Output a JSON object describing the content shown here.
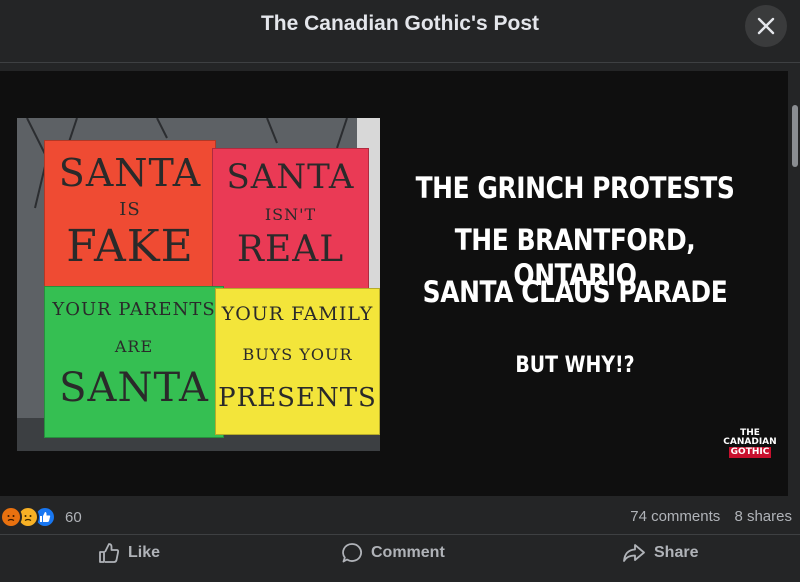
{
  "header": {
    "title": "The Canadian Gothic's Post"
  },
  "post": {
    "signs": [
      {
        "lines": [
          "SANTA",
          "IS",
          "FAKE"
        ],
        "color": "#ef4b33"
      },
      {
        "lines": [
          "SANTA",
          "ISN'T",
          "REAL"
        ],
        "color": "#ea3a55"
      },
      {
        "lines": [
          "YOUR PARENTS",
          "ARE",
          "SANTA"
        ],
        "color": "#35bf52"
      },
      {
        "lines": [
          "YOUR FAMILY",
          "BUYS YOUR",
          "PRESENTS"
        ],
        "color": "#f3e53a"
      }
    ],
    "headline": [
      "THE GRINCH PROTESTS",
      "THE BRANTFORD, ONTARIO",
      "SANTA CLAUS PARADE"
    ],
    "subhead": "BUT WHY!?",
    "logo_text": [
      "THE",
      "CANADIAN",
      "GOTHIC"
    ]
  },
  "stats": {
    "reaction_icons": [
      "angry-reaction",
      "sad-reaction",
      "like-reaction"
    ],
    "reaction_count": "60",
    "comments": "74 comments",
    "shares": "8 shares"
  },
  "actions": {
    "like": "Like",
    "comment": "Comment",
    "share": "Share"
  },
  "colors": {
    "background": "#242526",
    "text": "#e4e6eb",
    "secondary": "#b0b3b8",
    "like_blue": "#1877f2",
    "angry_red": "#e9710f"
  }
}
